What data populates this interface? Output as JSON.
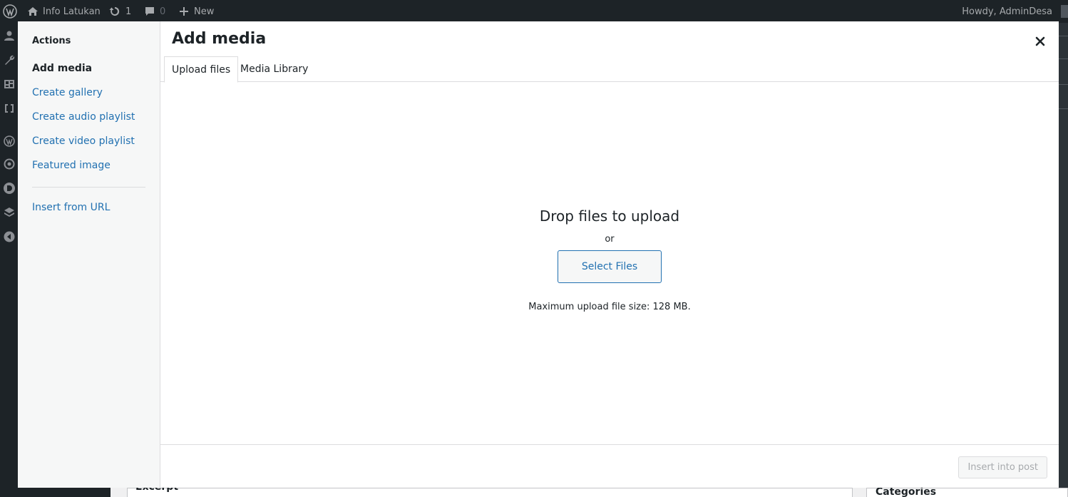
{
  "adminbar": {
    "site_name": "Info Latukan",
    "updates_count": "1",
    "comments_count": "0",
    "new_label": "New",
    "howdy": "Howdy, AdminDesa"
  },
  "background": {
    "excerpt_label": "Excerpt",
    "categories_label": "Categories"
  },
  "modal": {
    "title": "Add media",
    "menu": {
      "heading": "Actions",
      "items": [
        {
          "label": "Add media"
        },
        {
          "label": "Create gallery"
        },
        {
          "label": "Create audio playlist"
        },
        {
          "label": "Create video playlist"
        },
        {
          "label": "Featured image"
        },
        {
          "label": "Insert from URL"
        }
      ]
    },
    "tabs": [
      {
        "label": "Upload files"
      },
      {
        "label": "Media Library"
      }
    ],
    "upload": {
      "drop_title": "Drop files to upload",
      "or": "or",
      "select_button": "Select Files",
      "max_size": "Maximum upload file size: 128 MB."
    },
    "toolbar": {
      "insert_button": "Insert into post"
    }
  },
  "colors": {
    "accent": "#2271b1",
    "adminbar_bg": "#1d2327"
  }
}
